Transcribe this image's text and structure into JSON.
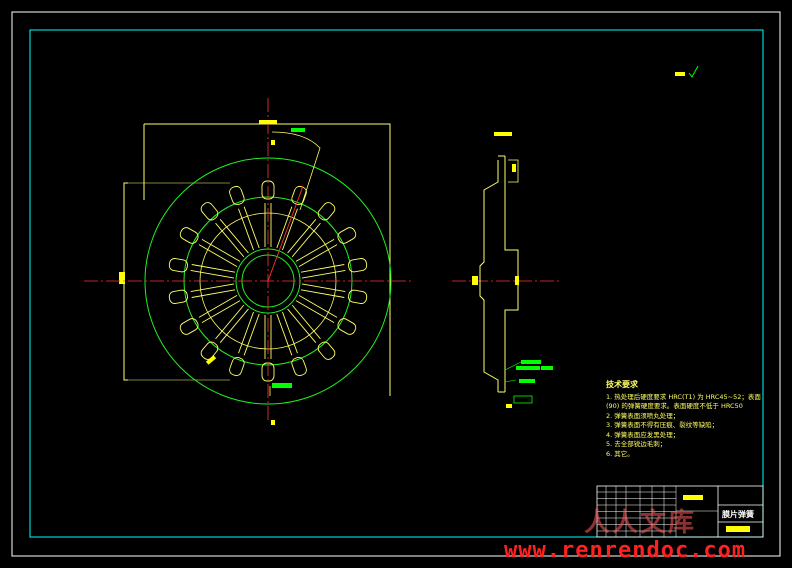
{
  "drawing": {
    "section_label": "A - A",
    "surface_mark": "▬ √",
    "title_block": {
      "part_name": "膜片弹簧",
      "small_code": "20RJ6",
      "drawing_no": "QDZ3U9U"
    }
  },
  "tech_requirements": {
    "title": "技术要求",
    "items": [
      "1. 热处理后硬度要求 HRC(T1) 为 HRC45~52；表面",
      "(90) 的弹簧硬度要求。表面硬度不低于 HRC50",
      "2. 弹簧表面须喷丸处理；",
      "3. 弹簧表面不得有压痕、裂纹等缺陷；",
      "4. 弹簧表面应发黑处理；",
      "5. 去全部锐边毛刺；",
      "6. 其它。"
    ]
  },
  "watermark": {
    "text": "www.renrendoc.com",
    "logo": "人人文库"
  },
  "colors": {
    "background": "#000000",
    "frame": "#ffffff",
    "border": "#00ffff",
    "geometry": "#ffff66",
    "circles": "#22ee22",
    "centerline": "#ff3333",
    "dimension": "#00ff00",
    "watermark": "#ff2020"
  }
}
